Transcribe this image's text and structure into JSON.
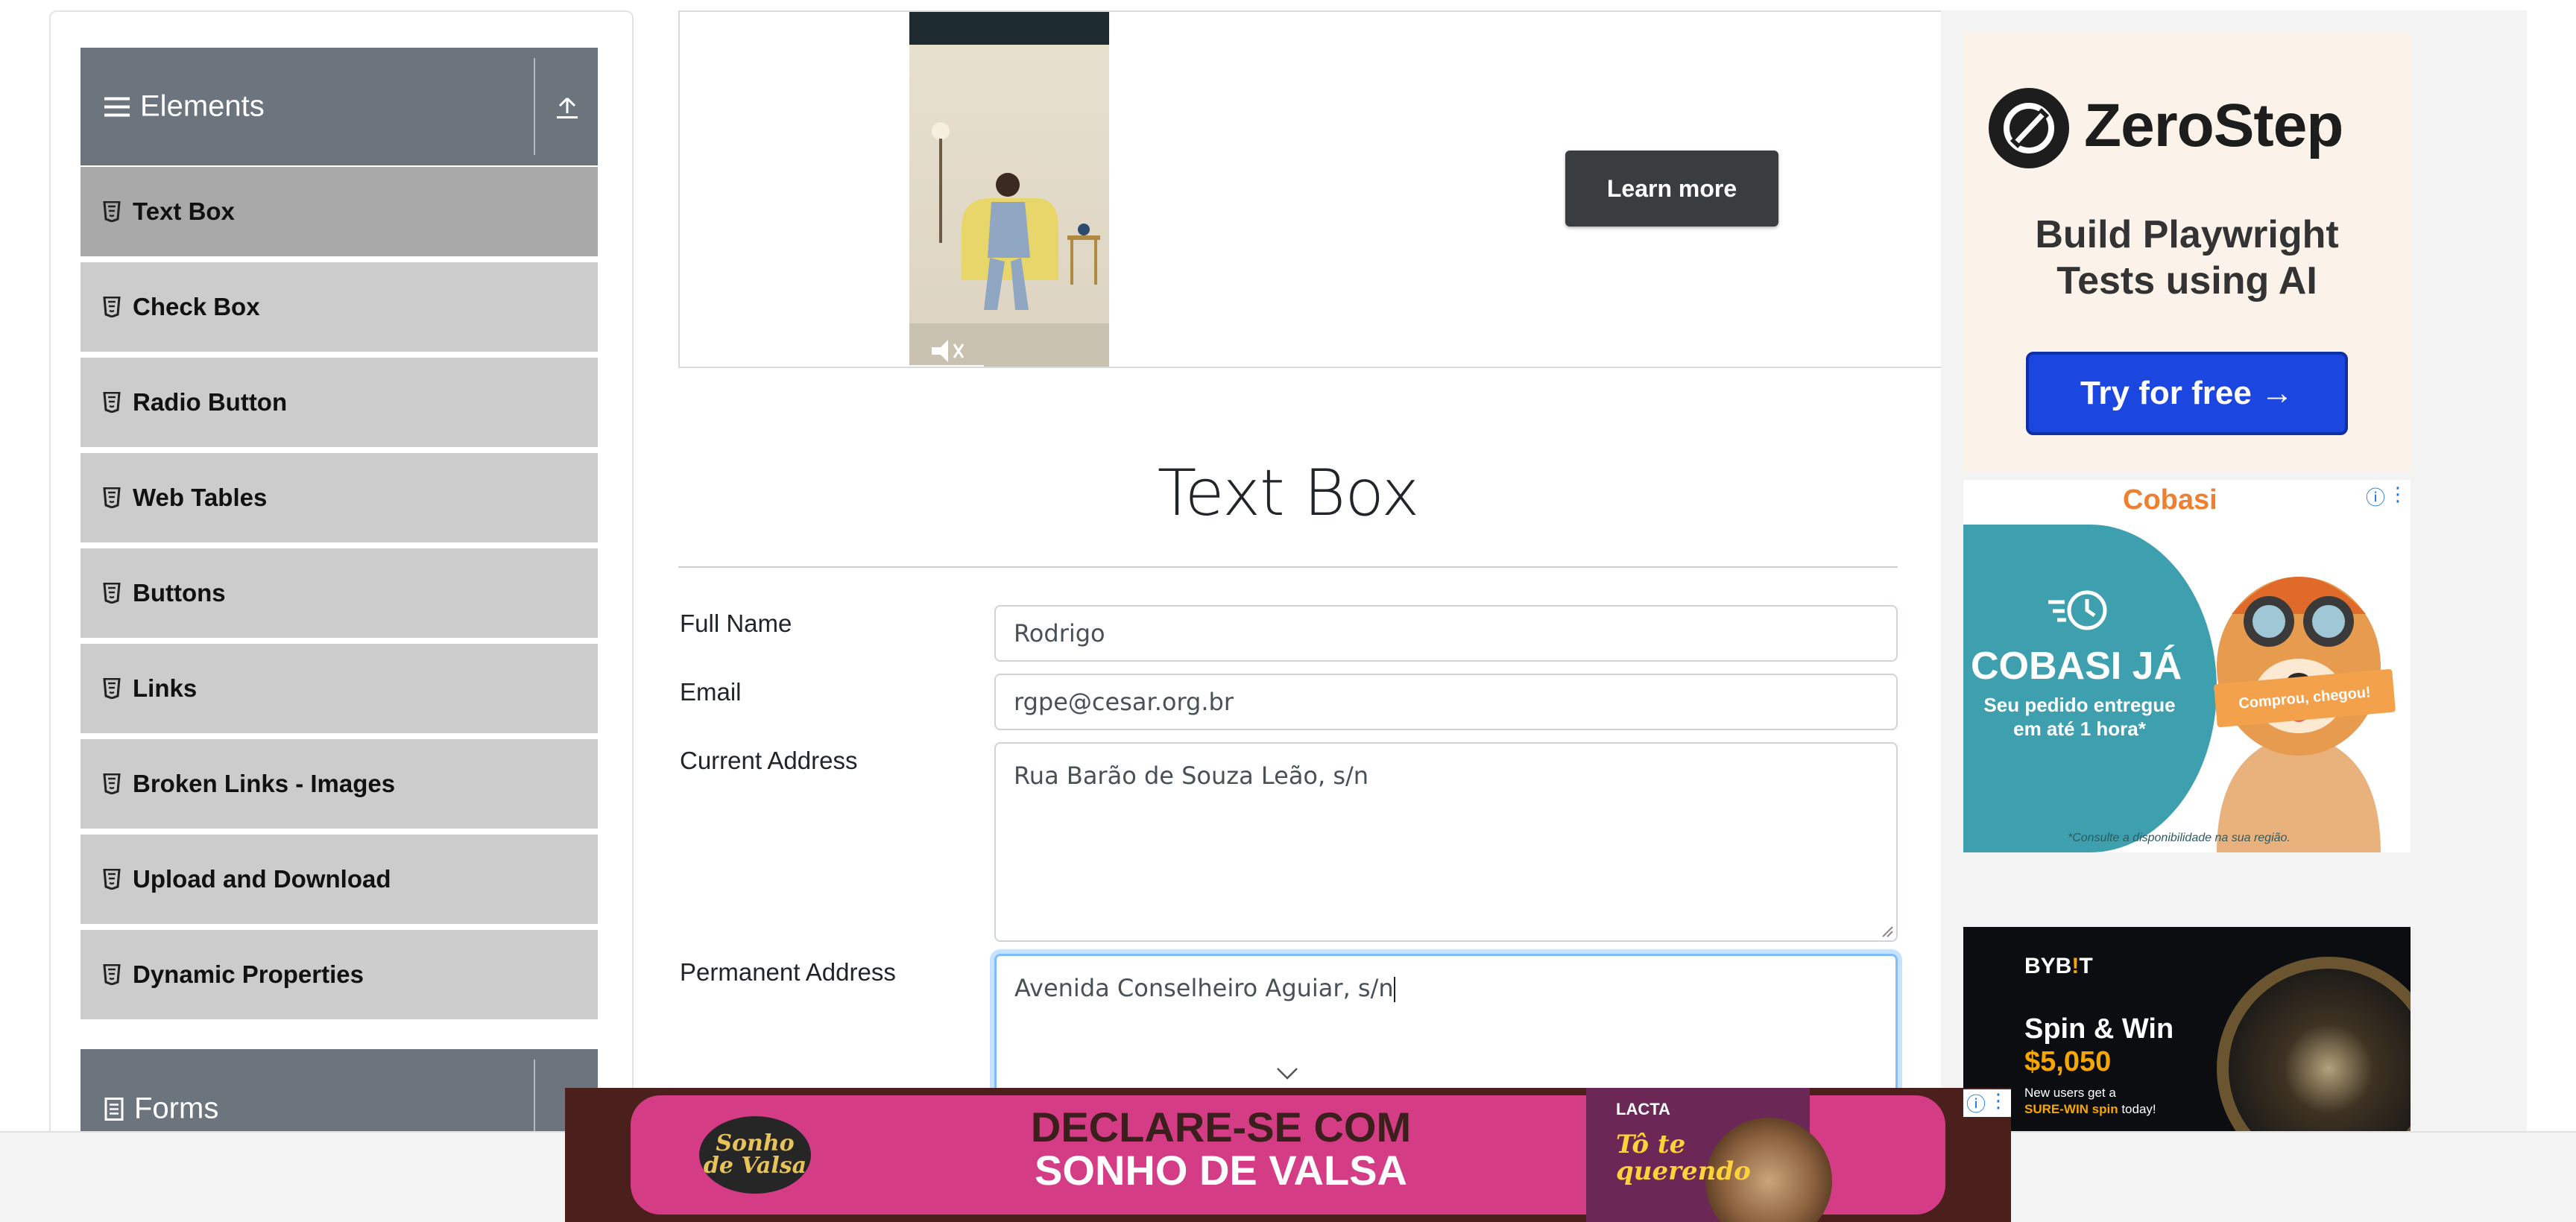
{
  "sidebar": {
    "group_elements": {
      "label": "Elements"
    },
    "items": [
      {
        "label": "Text Box",
        "active": true
      },
      {
        "label": "Check Box"
      },
      {
        "label": "Radio Button"
      },
      {
        "label": "Web Tables"
      },
      {
        "label": "Buttons"
      },
      {
        "label": "Links"
      },
      {
        "label": "Broken Links - Images"
      },
      {
        "label": "Upload and Download"
      },
      {
        "label": "Dynamic Properties"
      }
    ],
    "group_forms": {
      "label": "Forms"
    }
  },
  "top_ad": {
    "button_label": "Learn more"
  },
  "main": {
    "title": "Text Box",
    "fields": {
      "full_name": {
        "label": "Full Name",
        "value": "Rodrigo"
      },
      "email": {
        "label": "Email",
        "value": "rgpe@cesar.org.br"
      },
      "current_address": {
        "label": "Current Address",
        "value": "Rua Barão de Souza Leão, s/n"
      },
      "permanent_address": {
        "label": "Permanent Address",
        "value": "Avenida Conselheiro Aguiar, s/n"
      }
    }
  },
  "ads": {
    "zerostep": {
      "brand": "ZeroStep",
      "tagline_line1": "Build Playwright",
      "tagline_line2": "Tests using AI",
      "cta": "Try for free →"
    },
    "cobasi": {
      "brand": "Cobasi",
      "headline": "COBASI JÁ",
      "sub": "Seu pedido entregue em até 1 hora*",
      "box_text": "Comprou, chegou!",
      "note": "*Consulte a disponibilidade na sua região."
    },
    "bybit": {
      "logo_pre": "BYB",
      "logo_mark": "!",
      "logo_post": "T",
      "headline": "Spin & Win",
      "amount": "$5,050",
      "small_line1": "New users get a",
      "small_line2_em": "SURE-WIN spin",
      "small_line2_rest": " today!"
    },
    "banner": {
      "logo": "Sonho de Valsa",
      "line1": "DECLARE-SE COM",
      "line2": "SONHO DE VALSA",
      "product_brand": "LACTA",
      "product_slogan": "Tô te querendo"
    }
  },
  "colors": {
    "sidebar_header": "#6c757d",
    "sidebar_item": "#cccccc",
    "sidebar_item_active": "#a9a9a9",
    "focus_border": "#80bdff",
    "zerostep_button": "#1b47e0",
    "banner_pink": "#d43c86"
  }
}
